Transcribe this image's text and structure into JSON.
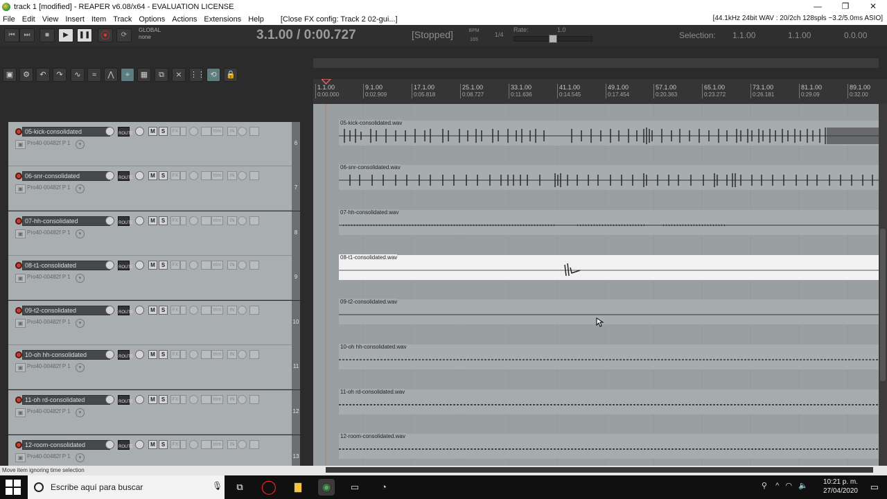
{
  "window": {
    "title": "track 1 [modified] - REAPER v6.08/x64 - EVALUATION LICENSE",
    "min": "—",
    "restore": "❐",
    "close": "✕"
  },
  "menu": {
    "items": [
      "File",
      "Edit",
      "View",
      "Insert",
      "Item",
      "Track",
      "Options",
      "Actions",
      "Extensions",
      "Help"
    ],
    "close_fx": "[Close FX config: Track 2 02-gui...]",
    "info": "[44.1kHz 24bit WAV : 20/2ch 128spls ~3.2/5.0ms ASIO]"
  },
  "transport": {
    "position": "3.1.00 / 0:00.727",
    "status": "[Stopped]",
    "bpm_label": "BPM",
    "bpm_value": "165",
    "time_sig": "1/4",
    "rate_label": "Rate:",
    "rate_value": "1.0",
    "rate_fraction": 0.5,
    "global_label": "GLOBAL",
    "global_value": "none",
    "selection_label": "Selection:",
    "selection_start": "1.1.00",
    "selection_end": "1.1.00",
    "selection_length": "0.0.00"
  },
  "ruler": {
    "ticks": [
      {
        "bar": "1.1.00",
        "time": "0:00.000"
      },
      {
        "bar": "9.1.00",
        "time": "0:02.909"
      },
      {
        "bar": "17.1.00",
        "time": "0:05.818"
      },
      {
        "bar": "25.1.00",
        "time": "0:08.727"
      },
      {
        "bar": "33.1.00",
        "time": "0:11.636"
      },
      {
        "bar": "41.1.00",
        "time": "0:14.545"
      },
      {
        "bar": "49.1.00",
        "time": "0:17.454"
      },
      {
        "bar": "57.1.00",
        "time": "0:20.363"
      },
      {
        "bar": "65.1.00",
        "time": "0:23.272"
      },
      {
        "bar": "73.1.00",
        "time": "0:26.181"
      },
      {
        "bar": "81.1.00",
        "time": "0:29.09"
      },
      {
        "bar": "89.1.00",
        "time": "0:32.00"
      }
    ]
  },
  "tcp": {
    "fx_label": "FX",
    "mute": "M",
    "solo": "S",
    "route": "ROUTE",
    "trim": "trim",
    "in_label": "IN",
    "fx_param": "Pro40-00482f P 1"
  },
  "tracks": [
    {
      "name": "05-kick-consolidated",
      "number": "6",
      "item": "05-kick-consolidated.wav"
    },
    {
      "name": "06-snr-consolidated",
      "number": "7",
      "item": "06-snr-consolidated.wav"
    },
    {
      "name": "07-hh-consolidated",
      "number": "8",
      "item": "07-hh-consolidated.wav"
    },
    {
      "name": "08-t1-consolidated",
      "number": "9",
      "item": "08-t1-consolidated.wav",
      "selected": true
    },
    {
      "name": "09-t2-consolidated",
      "number": "10",
      "item": "09-t2-consolidated.wav"
    },
    {
      "name": "10-oh hh-consolidated",
      "number": "11",
      "item": "10-oh hh-consolidated.wav"
    },
    {
      "name": "11-oh rd-consolidated",
      "number": "12",
      "item": "11-oh rd-consolidated.wav"
    },
    {
      "name": "12-room-consolidated",
      "number": "13",
      "item": "12-room-consolidated.wav"
    }
  ],
  "statusbar": {
    "text": "Move item ignoring time selection"
  },
  "taskbar": {
    "search_placeholder": "Escribe aquí para buscar",
    "time": "10:21 p. m.",
    "date": "27/04/2020"
  },
  "colors": {
    "accent_record": "#c1432f",
    "selected_item": "#f1f1f1",
    "track_bg": "#a9aeb1"
  }
}
